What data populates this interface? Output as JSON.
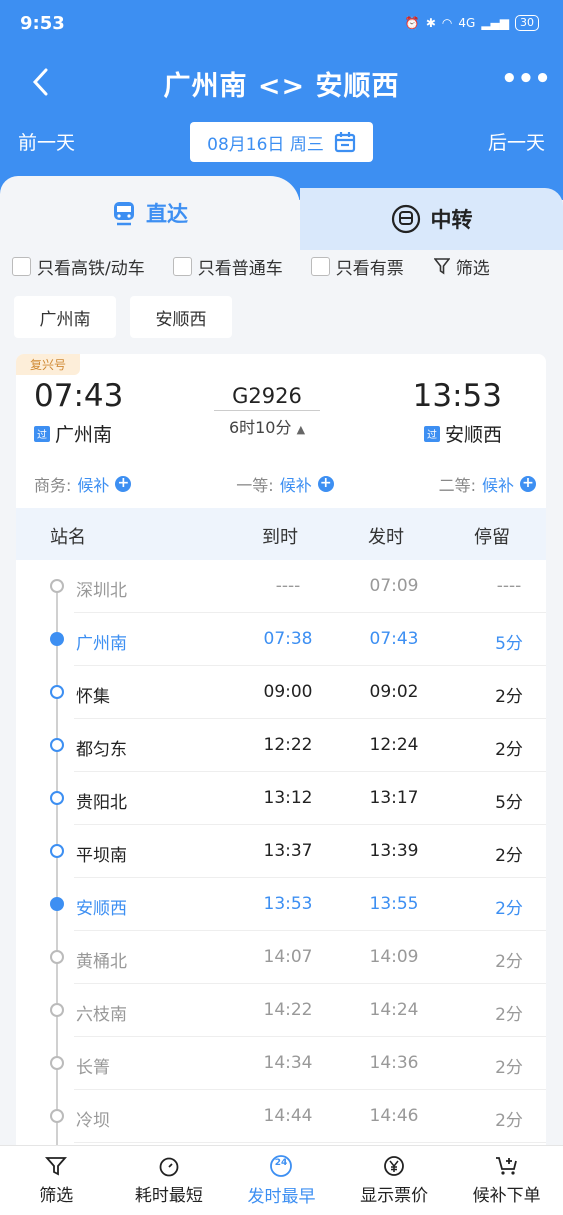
{
  "status": {
    "time": "9:53",
    "battery": "30",
    "network": "4G"
  },
  "nav": {
    "title": "广州南 <> 安顺西"
  },
  "date": {
    "prev": "前一天",
    "current": "08月16日 周三",
    "next": "后一天"
  },
  "tabs": {
    "direct": "直达",
    "transfer": "中转"
  },
  "filters": {
    "high_speed": "只看高铁/动车",
    "normal": "只看普通车",
    "available": "只看有票",
    "filter": "筛选"
  },
  "station_buttons": {
    "from": "广州南",
    "to": "安顺西"
  },
  "train": {
    "tag": "复兴号",
    "dep_time": "07:43",
    "arr_time": "13:53",
    "dep_station": "广州南",
    "arr_station": "安顺西",
    "via_label": "过",
    "number": "G2926",
    "duration": "6时10分"
  },
  "seats": [
    {
      "label": "商务:",
      "value": "候补"
    },
    {
      "label": "一等:",
      "value": "候补"
    },
    {
      "label": "二等:",
      "value": "候补"
    }
  ],
  "table_headers": {
    "name": "站名",
    "arrive": "到时",
    "depart": "发时",
    "stop": "停留"
  },
  "stations": [
    {
      "name": "深圳北",
      "arrive": "----",
      "depart": "07:09",
      "stop": "----"
    },
    {
      "name": "广州南",
      "arrive": "07:38",
      "depart": "07:43",
      "stop": "5分"
    },
    {
      "name": "怀集",
      "arrive": "09:00",
      "depart": "09:02",
      "stop": "2分"
    },
    {
      "name": "都匀东",
      "arrive": "12:22",
      "depart": "12:24",
      "stop": "2分"
    },
    {
      "name": "贵阳北",
      "arrive": "13:12",
      "depart": "13:17",
      "stop": "5分"
    },
    {
      "name": "平坝南",
      "arrive": "13:37",
      "depart": "13:39",
      "stop": "2分"
    },
    {
      "name": "安顺西",
      "arrive": "13:53",
      "depart": "13:55",
      "stop": "2分"
    },
    {
      "name": "黄桶北",
      "arrive": "14:07",
      "depart": "14:09",
      "stop": "2分"
    },
    {
      "name": "六枝南",
      "arrive": "14:22",
      "depart": "14:24",
      "stop": "2分"
    },
    {
      "name": "长箐",
      "arrive": "14:34",
      "depart": "14:36",
      "stop": "2分"
    },
    {
      "name": "冷坝",
      "arrive": "14:44",
      "depart": "14:46",
      "stop": "2分"
    }
  ],
  "bottom": {
    "filter": "筛选",
    "shortest": "耗时最短",
    "earliest": "发时最早",
    "earliest_badge": "24",
    "price": "显示票价",
    "waitlist": "候补下单"
  },
  "colors": {
    "accent": "#3d8ff2",
    "header_bg": "#3d8ff2"
  }
}
